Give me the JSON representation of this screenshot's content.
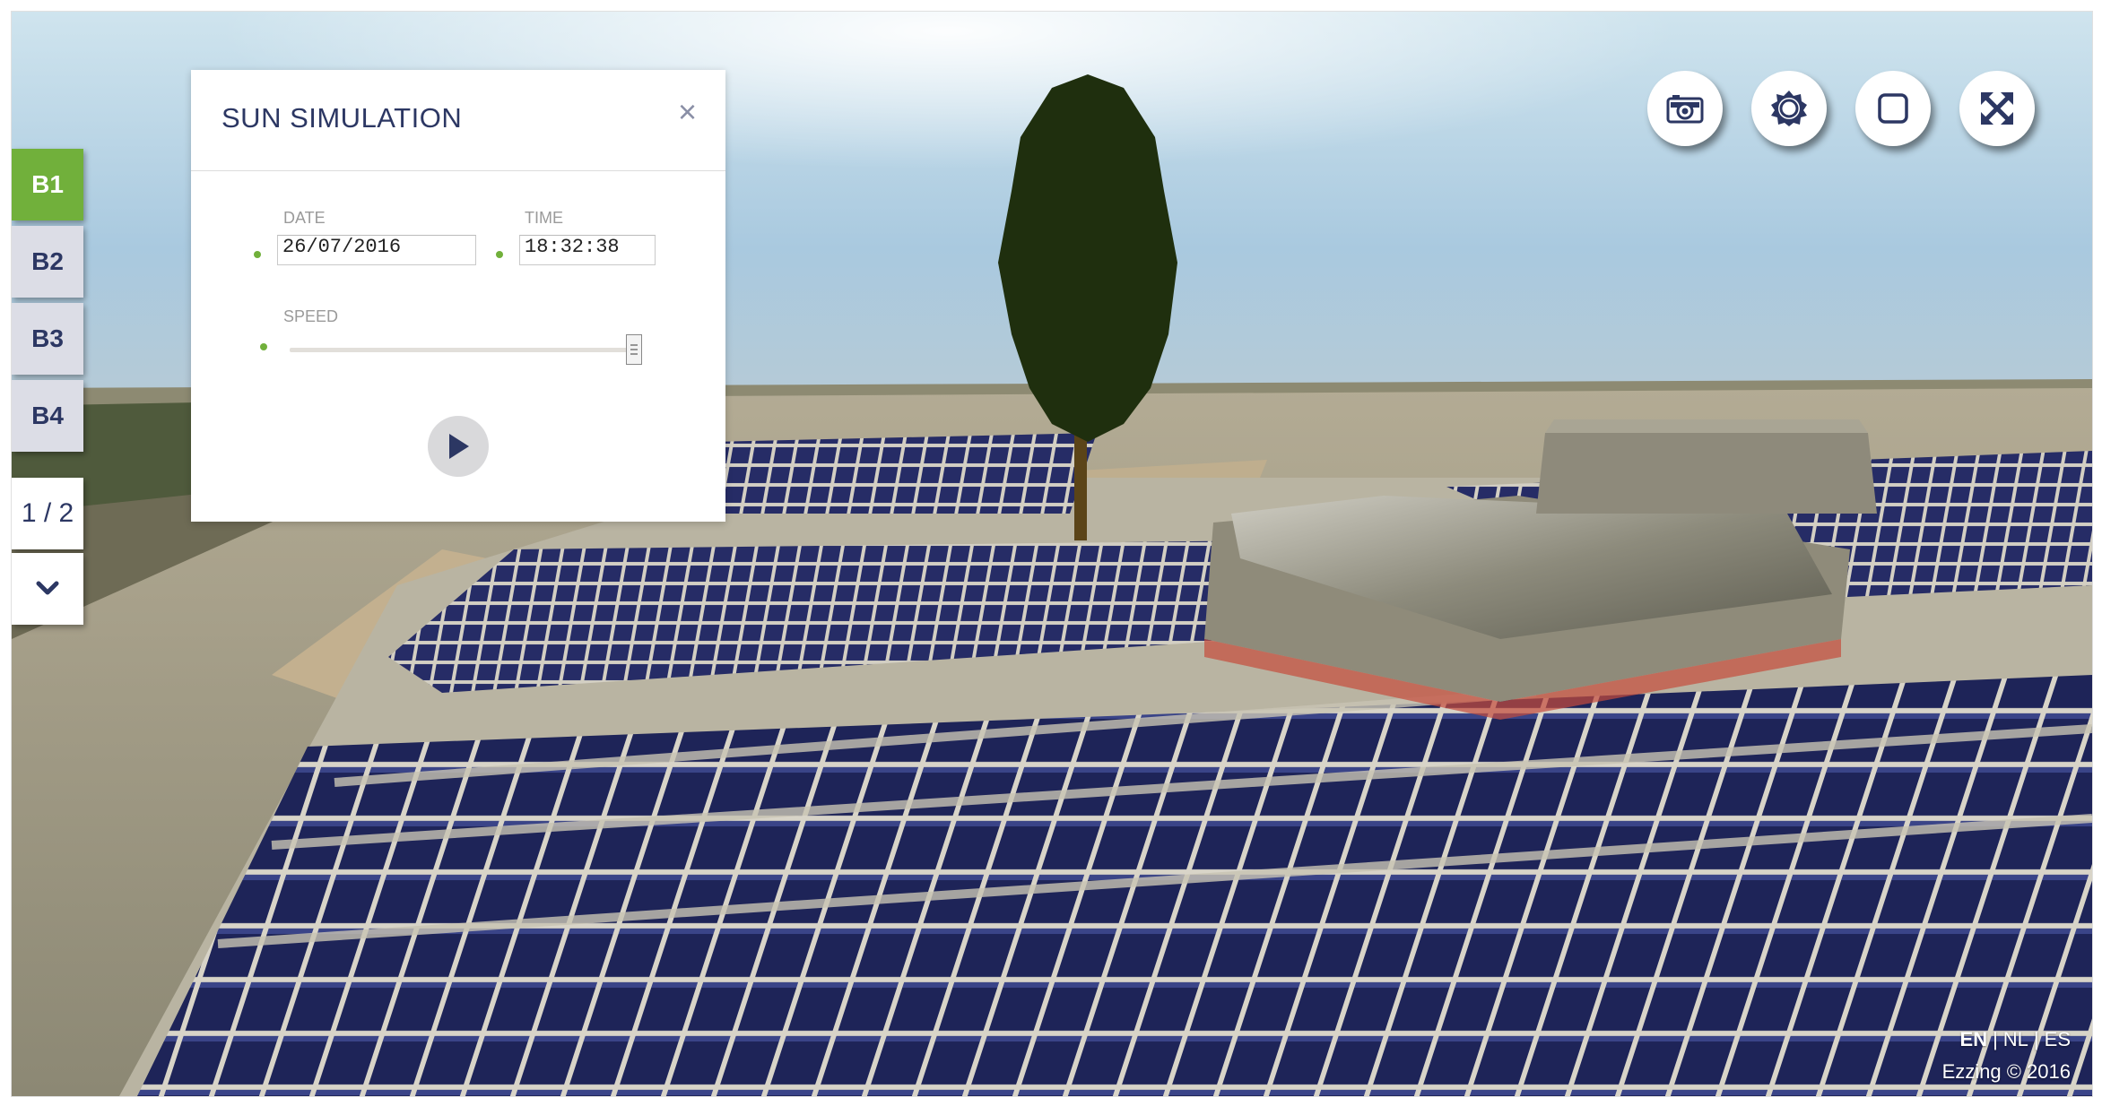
{
  "building_tabs": [
    {
      "label": "B1",
      "active": true
    },
    {
      "label": "B2",
      "active": false
    },
    {
      "label": "B3",
      "active": false
    },
    {
      "label": "B4",
      "active": false
    }
  ],
  "pager": {
    "label": "1 / 2",
    "next_icon": "chevron-down-icon"
  },
  "sun_panel": {
    "title": "SUN SIMULATION",
    "close_label": "×",
    "date_label": "DATE",
    "date_value": "26/07/2016",
    "time_label": "TIME",
    "time_value": "18:32:38",
    "speed_label": "SPEED",
    "speed_fraction": 0.98,
    "play_icon": "play-icon"
  },
  "toolbar": [
    {
      "icon": "camera-icon"
    },
    {
      "icon": "sun-icon"
    },
    {
      "icon": "square-icon"
    },
    {
      "icon": "fullscreen-icon"
    }
  ],
  "footer": {
    "languages": [
      "EN",
      "NL",
      "ES"
    ],
    "active_language": "EN",
    "separator": "|",
    "copyright": "Ezzing © 2016"
  },
  "colors": {
    "accent_green": "#71b03b",
    "navy": "#2c3763",
    "panel_bg": "#ffffff"
  }
}
